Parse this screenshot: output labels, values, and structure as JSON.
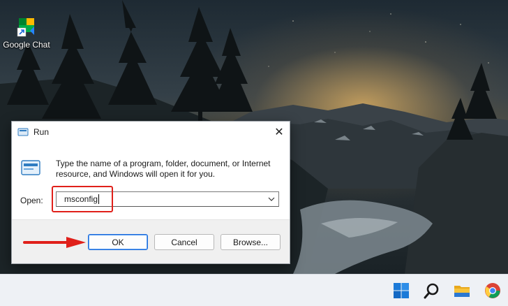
{
  "desktop": {
    "icons": [
      {
        "label": "Google Chat",
        "icon": "google-chat-icon"
      }
    ]
  },
  "run_dialog": {
    "title": "Run",
    "description": "Type the name of a program, folder, document, or Internet resource, and Windows will open it for you.",
    "open_label": "Open:",
    "open_value": "msconfig",
    "buttons": {
      "ok": "OK",
      "cancel": "Cancel",
      "browse": "Browse..."
    },
    "highlight_color": "#e0201a",
    "arrow_color": "#e0201a"
  },
  "taskbar": {
    "items": [
      "start-icon",
      "search-icon",
      "file-explorer-icon",
      "chrome-icon"
    ]
  },
  "colors": {
    "accent": "#1f6bd8",
    "taskbar_bg": "#eef1f5",
    "footer_bg": "#f0f0f0"
  }
}
